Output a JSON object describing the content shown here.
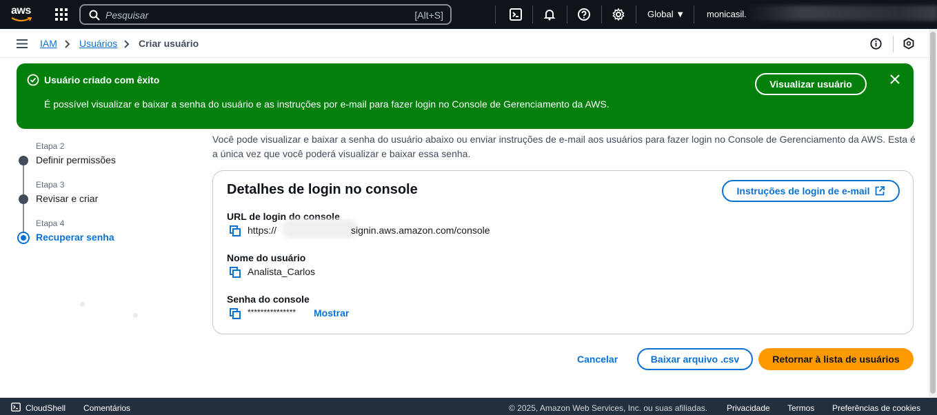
{
  "topnav": {
    "logo_text": "aws",
    "search_placeholder": "Pesquisar",
    "search_shortcut": "[Alt+S]",
    "region": "Global",
    "account": "monicasil."
  },
  "breadcrumb": {
    "items": [
      "IAM",
      "Usuários"
    ],
    "current": "Criar usuário"
  },
  "flash": {
    "title": "Usuário criado com êxito",
    "message": "É possível visualizar e baixar a senha do usuário e as instruções por e-mail para fazer login no Console de Gerenciamento da AWS.",
    "view_button": "Visualizar usuário",
    "color": "#037f0c"
  },
  "steps": [
    {
      "label": "Etapa 2",
      "name": "Definir permissões"
    },
    {
      "label": "Etapa 3",
      "name": "Revisar e criar"
    },
    {
      "label": "Etapa 4",
      "name": "Recuperar senha"
    }
  ],
  "intro": "Você pode visualizar e baixar a senha do usuário abaixo ou enviar instruções de e-mail aos usuários para fazer login no Console de Gerenciamento da AWS. Esta é a única vez que você poderá visualizar e baixar essa senha.",
  "card": {
    "title": "Detalhes de login no console",
    "email_button": "Instruções de login de e-mail",
    "url_label": "URL de login do console",
    "url_prefix": "https://",
    "url_suffix": "signin.aws.amazon.com/console",
    "user_label": "Nome do usuário",
    "user_value": "Analista_Carlos",
    "password_label": "Senha do console",
    "password_value": "***************",
    "show_link": "Mostrar"
  },
  "actions": {
    "cancel": "Cancelar",
    "download_csv": "Baixar arquivo .csv",
    "return": "Retornar à lista de usuários"
  },
  "footer": {
    "cloudshell": "CloudShell",
    "feedback": "Comentários",
    "copyright": "© 2025, Amazon Web Services, Inc. ou suas afiliadas.",
    "privacy": "Privacidade",
    "terms": "Termos",
    "cookies": "Preferências de cookies"
  },
  "colors": {
    "accent": "#0972d3",
    "primary_button": "#ff9900",
    "topnav": "#0f141a"
  }
}
